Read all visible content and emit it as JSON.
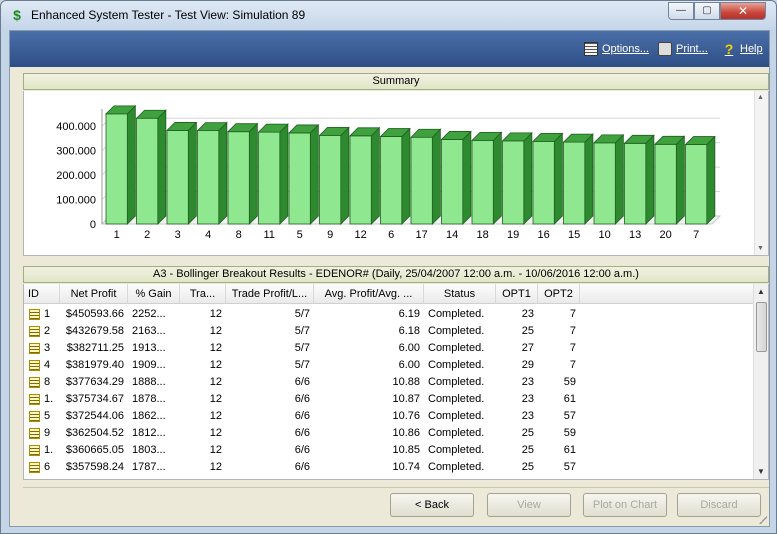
{
  "window": {
    "title": "Enhanced System Tester - Test View: Simulation 89",
    "app_icon_glyph": "$",
    "minimize_glyph": "—",
    "maximize_glyph": "▢",
    "close_glyph": "✕"
  },
  "toolbar": {
    "options_label": "Options...",
    "print_label": "Print...",
    "help_label": "Help"
  },
  "summary": {
    "header": "Summary"
  },
  "chart_data": {
    "type": "bar",
    "title": "",
    "categories": [
      "1",
      "2",
      "3",
      "4",
      "8",
      "11",
      "5",
      "9",
      "12",
      "6",
      "17",
      "14",
      "18",
      "19",
      "16",
      "15",
      "10",
      "13",
      "20",
      "7"
    ],
    "values": [
      450593.66,
      432679.58,
      382711.25,
      381979.4,
      377634.29,
      375734.67,
      372544.06,
      362504.52,
      360665.05,
      357598.24,
      355000,
      346000,
      342000,
      340000,
      338000,
      335000,
      332000,
      330000,
      326000,
      325000
    ],
    "ylim": [
      0,
      450000
    ],
    "y_ticks": [
      "0",
      "100.000",
      "200.000",
      "300.000",
      "400.000"
    ],
    "grid": true,
    "bar_color": "#8fe88f",
    "bar_side_color": "#2e8a2e"
  },
  "results": {
    "header": "A3 - Bollinger Breakout Results - EDENOR# (Daily, 25/04/2007 12:00 a.m. - 10/06/2016 12:00 a.m.)",
    "columns": [
      "ID",
      "Net Profit",
      "% Gain",
      "Tra...",
      "Trade Profit/L...",
      "Avg. Profit/Avg. ...",
      "Status",
      "OPT1",
      "OPT2"
    ],
    "rows": [
      {
        "id": "1",
        "net": "$450593.66",
        "gain": "2252...",
        "trades": "12",
        "tpl": "5/7",
        "avg": "6.19",
        "status": "Completed.",
        "opt1": "23",
        "opt2": "7"
      },
      {
        "id": "2",
        "net": "$432679.58",
        "gain": "2163...",
        "trades": "12",
        "tpl": "5/7",
        "avg": "6.18",
        "status": "Completed.",
        "opt1": "25",
        "opt2": "7"
      },
      {
        "id": "3",
        "net": "$382711.25",
        "gain": "1913...",
        "trades": "12",
        "tpl": "5/7",
        "avg": "6.00",
        "status": "Completed.",
        "opt1": "27",
        "opt2": "7"
      },
      {
        "id": "4",
        "net": "$381979.40",
        "gain": "1909...",
        "trades": "12",
        "tpl": "5/7",
        "avg": "6.00",
        "status": "Completed.",
        "opt1": "29",
        "opt2": "7"
      },
      {
        "id": "8",
        "net": "$377634.29",
        "gain": "1888...",
        "trades": "12",
        "tpl": "6/6",
        "avg": "10.88",
        "status": "Completed.",
        "opt1": "23",
        "opt2": "59"
      },
      {
        "id": "1.",
        "net": "$375734.67",
        "gain": "1878...",
        "trades": "12",
        "tpl": "6/6",
        "avg": "10.87",
        "status": "Completed.",
        "opt1": "23",
        "opt2": "61"
      },
      {
        "id": "5",
        "net": "$372544.06",
        "gain": "1862...",
        "trades": "12",
        "tpl": "6/6",
        "avg": "10.76",
        "status": "Completed.",
        "opt1": "23",
        "opt2": "57"
      },
      {
        "id": "9",
        "net": "$362504.52",
        "gain": "1812...",
        "trades": "12",
        "tpl": "6/6",
        "avg": "10.86",
        "status": "Completed.",
        "opt1": "25",
        "opt2": "59"
      },
      {
        "id": "1.",
        "net": "$360665.05",
        "gain": "1803...",
        "trades": "12",
        "tpl": "6/6",
        "avg": "10.85",
        "status": "Completed.",
        "opt1": "25",
        "opt2": "61"
      },
      {
        "id": "6",
        "net": "$357598.24",
        "gain": "1787...",
        "trades": "12",
        "tpl": "6/6",
        "avg": "10.74",
        "status": "Completed.",
        "opt1": "25",
        "opt2": "57"
      }
    ]
  },
  "buttons": {
    "back": "< Back",
    "view": "View",
    "plot": "Plot on Chart",
    "discard": "Discard"
  }
}
